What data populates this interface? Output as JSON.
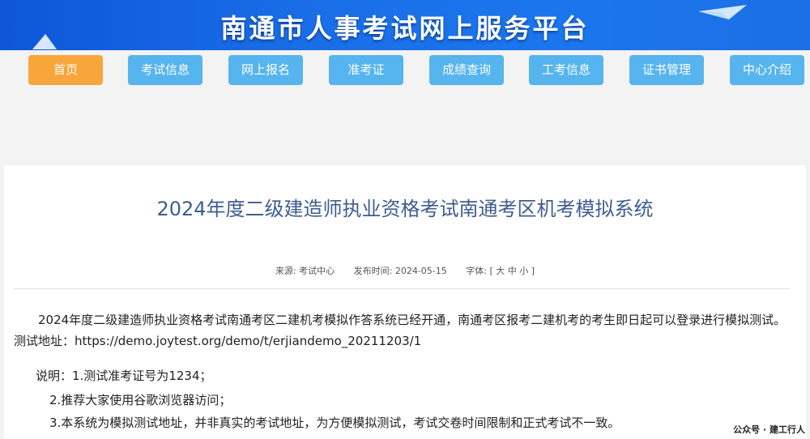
{
  "header": {
    "title": "南通市人事考试网上服务平台"
  },
  "nav": {
    "items": [
      {
        "label": "首页",
        "active": true
      },
      {
        "label": "考试信息",
        "active": false
      },
      {
        "label": "网上报名",
        "active": false
      },
      {
        "label": "准考证",
        "active": false
      },
      {
        "label": "成绩查询",
        "active": false
      },
      {
        "label": "工考信息",
        "active": false
      },
      {
        "label": "证书管理",
        "active": false
      },
      {
        "label": "中心介绍",
        "active": false
      }
    ]
  },
  "article": {
    "title": "2024年度二级建造师执业资格考试南通考区机考模拟系统",
    "source": "来源: 考试中心",
    "publish_time": "发布时间: 2024-05-15",
    "font_size_label": "字体: [ 大 中 小 ]",
    "paragraph": "2024年度二级建造师执业资格考试南通考区二建机考模拟作答系统已经开通，南通考区报考二建机考的考生即日起可以登录进行模拟测试。测试地址：https://demo.joytest.org/demo/t/erjiandemo_20211203/1",
    "notes": [
      "说明：1.测试准考证号为1234；",
      "2.推荐大家使用谷歌浏览器访问；",
      "3.本系统为模拟测试地址，并非真实的考试地址，为方便模拟测试，考试交卷时间限制和正式考试不一致。"
    ]
  },
  "watermark": "公众号 · 建工行人",
  "colors": {
    "banner": "#1a6fe8",
    "nav_button": "#56b4ef",
    "nav_active": "#f7a63a",
    "title": "#3f5d8f"
  }
}
